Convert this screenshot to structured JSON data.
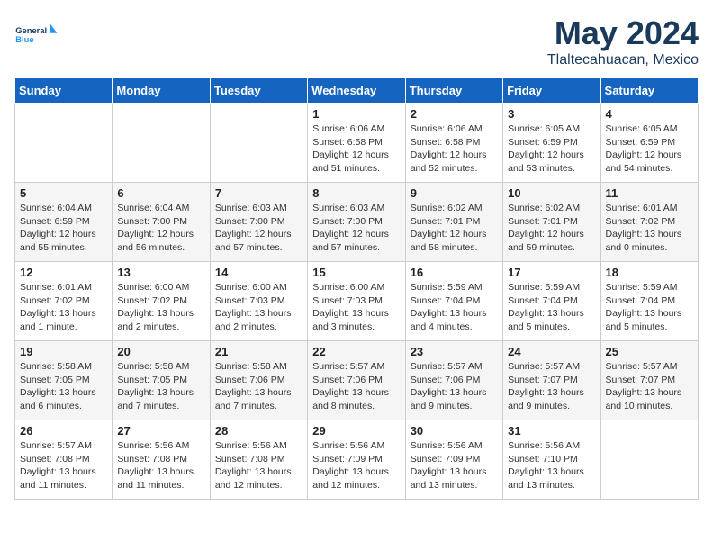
{
  "header": {
    "logo_line1": "General",
    "logo_line2": "Blue",
    "month": "May 2024",
    "location": "Tlaltecahuacan, Mexico"
  },
  "days_of_week": [
    "Sunday",
    "Monday",
    "Tuesday",
    "Wednesday",
    "Thursday",
    "Friday",
    "Saturday"
  ],
  "weeks": [
    [
      {
        "day": "",
        "info": ""
      },
      {
        "day": "",
        "info": ""
      },
      {
        "day": "",
        "info": ""
      },
      {
        "day": "1",
        "info": "Sunrise: 6:06 AM\nSunset: 6:58 PM\nDaylight: 12 hours\nand 51 minutes."
      },
      {
        "day": "2",
        "info": "Sunrise: 6:06 AM\nSunset: 6:58 PM\nDaylight: 12 hours\nand 52 minutes."
      },
      {
        "day": "3",
        "info": "Sunrise: 6:05 AM\nSunset: 6:59 PM\nDaylight: 12 hours\nand 53 minutes."
      },
      {
        "day": "4",
        "info": "Sunrise: 6:05 AM\nSunset: 6:59 PM\nDaylight: 12 hours\nand 54 minutes."
      }
    ],
    [
      {
        "day": "5",
        "info": "Sunrise: 6:04 AM\nSunset: 6:59 PM\nDaylight: 12 hours\nand 55 minutes."
      },
      {
        "day": "6",
        "info": "Sunrise: 6:04 AM\nSunset: 7:00 PM\nDaylight: 12 hours\nand 56 minutes."
      },
      {
        "day": "7",
        "info": "Sunrise: 6:03 AM\nSunset: 7:00 PM\nDaylight: 12 hours\nand 57 minutes."
      },
      {
        "day": "8",
        "info": "Sunrise: 6:03 AM\nSunset: 7:00 PM\nDaylight: 12 hours\nand 57 minutes."
      },
      {
        "day": "9",
        "info": "Sunrise: 6:02 AM\nSunset: 7:01 PM\nDaylight: 12 hours\nand 58 minutes."
      },
      {
        "day": "10",
        "info": "Sunrise: 6:02 AM\nSunset: 7:01 PM\nDaylight: 12 hours\nand 59 minutes."
      },
      {
        "day": "11",
        "info": "Sunrise: 6:01 AM\nSunset: 7:02 PM\nDaylight: 13 hours\nand 0 minutes."
      }
    ],
    [
      {
        "day": "12",
        "info": "Sunrise: 6:01 AM\nSunset: 7:02 PM\nDaylight: 13 hours\nand 1 minute."
      },
      {
        "day": "13",
        "info": "Sunrise: 6:00 AM\nSunset: 7:02 PM\nDaylight: 13 hours\nand 2 minutes."
      },
      {
        "day": "14",
        "info": "Sunrise: 6:00 AM\nSunset: 7:03 PM\nDaylight: 13 hours\nand 2 minutes."
      },
      {
        "day": "15",
        "info": "Sunrise: 6:00 AM\nSunset: 7:03 PM\nDaylight: 13 hours\nand 3 minutes."
      },
      {
        "day": "16",
        "info": "Sunrise: 5:59 AM\nSunset: 7:04 PM\nDaylight: 13 hours\nand 4 minutes."
      },
      {
        "day": "17",
        "info": "Sunrise: 5:59 AM\nSunset: 7:04 PM\nDaylight: 13 hours\nand 5 minutes."
      },
      {
        "day": "18",
        "info": "Sunrise: 5:59 AM\nSunset: 7:04 PM\nDaylight: 13 hours\nand 5 minutes."
      }
    ],
    [
      {
        "day": "19",
        "info": "Sunrise: 5:58 AM\nSunset: 7:05 PM\nDaylight: 13 hours\nand 6 minutes."
      },
      {
        "day": "20",
        "info": "Sunrise: 5:58 AM\nSunset: 7:05 PM\nDaylight: 13 hours\nand 7 minutes."
      },
      {
        "day": "21",
        "info": "Sunrise: 5:58 AM\nSunset: 7:06 PM\nDaylight: 13 hours\nand 7 minutes."
      },
      {
        "day": "22",
        "info": "Sunrise: 5:57 AM\nSunset: 7:06 PM\nDaylight: 13 hours\nand 8 minutes."
      },
      {
        "day": "23",
        "info": "Sunrise: 5:57 AM\nSunset: 7:06 PM\nDaylight: 13 hours\nand 9 minutes."
      },
      {
        "day": "24",
        "info": "Sunrise: 5:57 AM\nSunset: 7:07 PM\nDaylight: 13 hours\nand 9 minutes."
      },
      {
        "day": "25",
        "info": "Sunrise: 5:57 AM\nSunset: 7:07 PM\nDaylight: 13 hours\nand 10 minutes."
      }
    ],
    [
      {
        "day": "26",
        "info": "Sunrise: 5:57 AM\nSunset: 7:08 PM\nDaylight: 13 hours\nand 11 minutes."
      },
      {
        "day": "27",
        "info": "Sunrise: 5:56 AM\nSunset: 7:08 PM\nDaylight: 13 hours\nand 11 minutes."
      },
      {
        "day": "28",
        "info": "Sunrise: 5:56 AM\nSunset: 7:08 PM\nDaylight: 13 hours\nand 12 minutes."
      },
      {
        "day": "29",
        "info": "Sunrise: 5:56 AM\nSunset: 7:09 PM\nDaylight: 13 hours\nand 12 minutes."
      },
      {
        "day": "30",
        "info": "Sunrise: 5:56 AM\nSunset: 7:09 PM\nDaylight: 13 hours\nand 13 minutes."
      },
      {
        "day": "31",
        "info": "Sunrise: 5:56 AM\nSunset: 7:10 PM\nDaylight: 13 hours\nand 13 minutes."
      },
      {
        "day": "",
        "info": ""
      }
    ]
  ]
}
